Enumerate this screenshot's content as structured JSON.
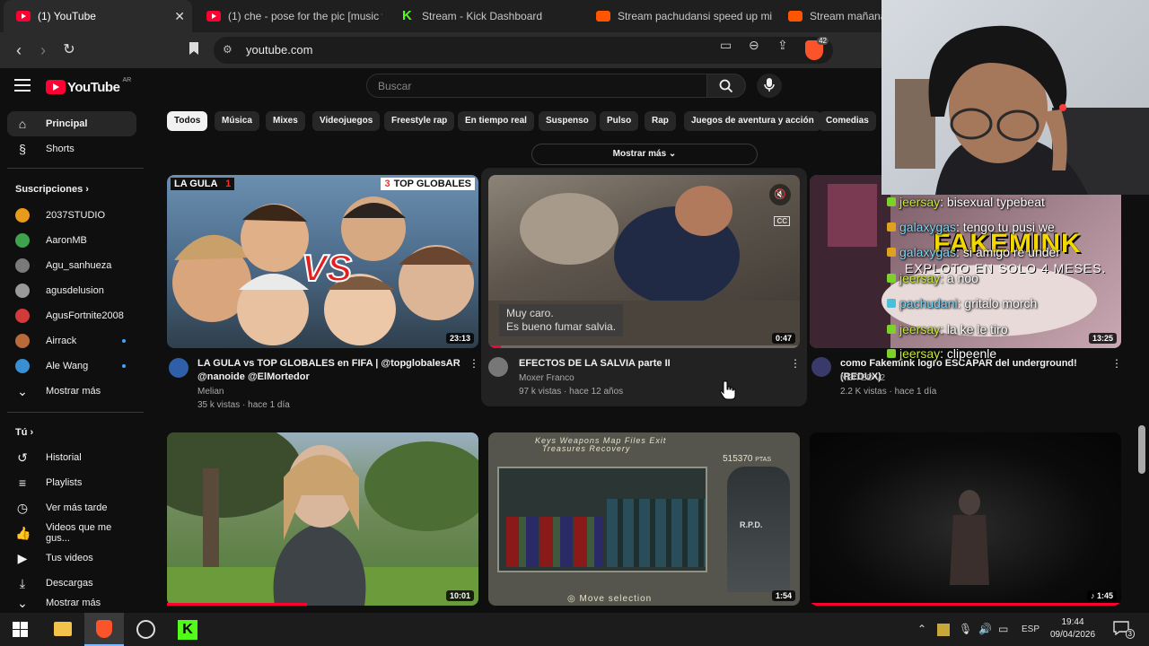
{
  "browser": {
    "tabs": [
      {
        "title": "(1) YouTube",
        "icon": "youtube-icon",
        "active": true
      },
      {
        "title": "(1) che - pose for the pic [music vi",
        "icon": "youtube-icon"
      },
      {
        "title": "Stream - Kick Dashboard",
        "icon": "kick-icon"
      },
      {
        "title": "Stream pachudansi speed up mixe",
        "icon": "soundcloud-icon"
      },
      {
        "title": "Stream mañana",
        "icon": "soundcloud-icon"
      }
    ],
    "url": "youtube.com",
    "brave_badge": "42"
  },
  "youtube": {
    "logo_text": "YouTube",
    "country": "AR",
    "search_placeholder": "Buscar",
    "sidebar": {
      "main": [
        {
          "label": "Principal",
          "icon": "home-icon",
          "active": true
        },
        {
          "label": "Shorts",
          "icon": "shorts-icon"
        }
      ],
      "subscriptions_header": "Suscripciones",
      "subscriptions": [
        {
          "label": "2037STUDIO",
          "color": "#e89a1a"
        },
        {
          "label": "AaronMB",
          "color": "#3fa34d"
        },
        {
          "label": "Agu_sanhueza",
          "color": "#7a7a7a"
        },
        {
          "label": "agusdelusion",
          "color": "#9a9a9a"
        },
        {
          "label": "AgusFortnite2008",
          "color": "#d23a3a"
        },
        {
          "label": "Airrack",
          "color": "#b86a3a",
          "dot": true
        },
        {
          "label": "Ale Wang",
          "color": "#3a8fd2",
          "dot": true
        }
      ],
      "show_more": "Mostrar más",
      "you_header": "Tú",
      "you": [
        {
          "label": "Historial",
          "icon": "history-icon"
        },
        {
          "label": "Playlists",
          "icon": "playlist-icon"
        },
        {
          "label": "Ver más tarde",
          "icon": "clock-icon"
        },
        {
          "label": "Videos que me gus...",
          "icon": "thumbs-up-icon"
        },
        {
          "label": "Tus videos",
          "icon": "video-icon"
        },
        {
          "label": "Descargas",
          "icon": "download-icon"
        },
        {
          "label": "Mostrar más",
          "icon": "chevron-down-icon"
        }
      ]
    },
    "chips": [
      "Todos",
      "Música",
      "Mixes",
      "Videojuegos",
      "Freestyle rap",
      "En tiempo real",
      "Suspenso",
      "Pulso",
      "Rap",
      "Juegos de aventura y acción",
      "Comedias"
    ],
    "chips_show_more": "Mostrar más",
    "videos": [
      {
        "title_line1": "LA GULA vs TOP GLOBALES en FIFA | @topglobalesAR",
        "title_line2": "@nanoide @ElMortedor",
        "channel": "Melian",
        "meta": "35 k vistas · hace 1 día",
        "duration": "23:13",
        "thumb_left_tag": "LA GULA",
        "thumb_left_num": "1",
        "thumb_right_num": "3",
        "thumb_right_tag": "TOP GLOBALES",
        "thumb_vs": "VS"
      },
      {
        "title_line1": "EFECTOS DE LA SALVIA parte II",
        "channel": "Moxer Franco",
        "meta": "97 k vistas · hace 12 años",
        "duration": "0:47",
        "caption_line1": "Muy caro.",
        "caption_line2": "Es bueno fumar salvia.",
        "cc": "CC"
      },
      {
        "title_line1": "como Fakemink logro ESCAPAR del underground! (REDUX)",
        "channel": "NEITED v2",
        "meta": "2.2 K vistas · hace 1 día",
        "duration": "13:25",
        "thumb_big": "FAKEMINK",
        "thumb_sub": "EXPLOTO EN SOLO 4 MESES."
      },
      {
        "duration": "10:01"
      },
      {
        "duration": "1:54",
        "inv_tabs": "Keys Weapons Map Files Exit",
        "inv_tabs2": "Treasures Recovery",
        "ptas": "515370",
        "ptas_unit": "PTAS",
        "footer": "Move selection",
        "rpd": "R.P.D."
      },
      {
        "duration": "1:45"
      }
    ]
  },
  "chat_overlay": [
    {
      "user": "jeersay",
      "msg": "bisexual typebeat"
    },
    {
      "user": "galaxygas",
      "msg": "tengo tu pusi we"
    },
    {
      "user": "galaxygas",
      "msg": "si amigo re under"
    },
    {
      "user": "jeersay",
      "msg": "a noo"
    },
    {
      "user": "pachudani",
      "msg": "gritalo morch"
    },
    {
      "user": "jeersay",
      "msg": "la ke le tiro"
    },
    {
      "user": "jeersay",
      "msg": "clipeenle"
    }
  ],
  "taskbar": {
    "lang": "ESP",
    "time": "19:44",
    "date": "09/04/2026",
    "notifications": "3"
  }
}
